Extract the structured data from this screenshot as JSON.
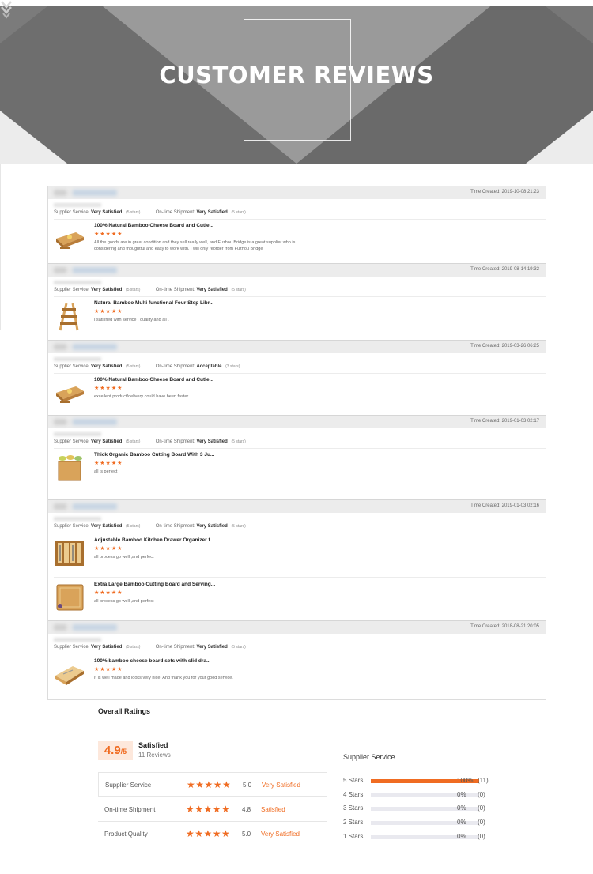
{
  "hero": {
    "title": "CUSTOMER REVIEWS"
  },
  "reviews": [
    {
      "time": "Time Created: 2019-10-08 21:23",
      "supplier_service_label": "Supplier Service:",
      "supplier_service_value": "Very Satisfied",
      "supplier_service_stars": "(5 stars)",
      "shipment_label": "On-time Shipment:",
      "shipment_value": "Very Satisfied",
      "shipment_stars": "(5 stars)",
      "items": [
        {
          "title": "100% Natural Bamboo Cheese Board and Cutle...",
          "stars": "★★★★★",
          "comment": "All the goods are in great condition and they sell really well, and Fuzhou Bridge is a great supplier who is considering and thoughtful and easy to work with. I will only reorder from Fuzhou Bridge",
          "thumb": "cheese-board"
        }
      ]
    },
    {
      "time": "Time Created: 2019-08-14 19:32",
      "supplier_service_label": "Supplier Service:",
      "supplier_service_value": "Very Satisfied",
      "supplier_service_stars": "(5 stars)",
      "shipment_label": "On-time Shipment:",
      "shipment_value": "Very Satisfied",
      "shipment_stars": "(5 stars)",
      "items": [
        {
          "title": "Natural Bamboo Multi functional Four Step Libr...",
          "stars": "★★★★★",
          "comment": "I satisfied with service , quality and all .",
          "thumb": "step-ladder"
        }
      ]
    },
    {
      "time": "Time Created: 2019-03-26 06:25",
      "supplier_service_label": "Supplier Service:",
      "supplier_service_value": "Very Satisfied",
      "supplier_service_stars": "(5 stars)",
      "shipment_label": "On-time Shipment:",
      "shipment_value": "Acceptable",
      "shipment_stars": "(3 stars)",
      "items": [
        {
          "title": "100% Natural Bamboo Cheese Board and Cutle...",
          "stars": "★★★★★",
          "comment": "excellent product!delivery could have been faster.",
          "thumb": "cheese-board"
        }
      ]
    },
    {
      "time": "Time Created: 2019-01-03 02:17",
      "supplier_service_label": "Supplier Service:",
      "supplier_service_value": "Very Satisfied",
      "supplier_service_stars": "(5 stars)",
      "shipment_label": "On-time Shipment:",
      "shipment_value": "Very Satisfied",
      "shipment_stars": "(5 stars)",
      "items": [
        {
          "title": "Thick Organic Bamboo Cutting Board With 3 Ju...",
          "stars": "★★★★★",
          "comment": "all is perfect",
          "thumb": "cutting-board-bowls"
        }
      ]
    },
    {
      "time": "Time Created: 2019-01-03 02:16",
      "supplier_service_label": "Supplier Service:",
      "supplier_service_value": "Very Satisfied",
      "supplier_service_stars": "(5 stars)",
      "shipment_label": "On-time Shipment:",
      "shipment_value": "Very Satisfied",
      "shipment_stars": "(5 stars)",
      "items": [
        {
          "title": "Adjustable Bamboo Kitchen Drawer Organizer f...",
          "stars": "★★★★★",
          "comment": "all process go well ,and perfect",
          "thumb": "drawer-organizer"
        },
        {
          "title": "Extra Large Bamboo Cutting Board and Serving...",
          "stars": "★★★★★",
          "comment": "all process go well ,and perfect",
          "thumb": "large-cutting-board"
        }
      ]
    },
    {
      "time": "Time Created: 2018-08-21 20:05",
      "supplier_service_label": "Supplier Service:",
      "supplier_service_value": "Very Satisfied",
      "supplier_service_stars": "(5 stars)",
      "shipment_label": "On-time Shipment:",
      "shipment_value": "Very Satisfied",
      "shipment_stars": "(5 stars)",
      "items": [
        {
          "title": "100% bamboo cheese board sets with slid dra...",
          "stars": "★★★★★",
          "comment": "It is well made and looks very nice! And thank you for your good service.",
          "thumb": "cheese-board-set"
        }
      ]
    }
  ],
  "overall": {
    "title": "Overall Ratings",
    "score": "4.9",
    "score_suffix": "/5",
    "label": "Satisfied",
    "review_count": "11 Reviews",
    "rows": [
      {
        "name": "Supplier Service",
        "stars": "★★★★★",
        "value": "5.0",
        "level": "Very Satisfied"
      },
      {
        "name": "On-time Shipment",
        "stars": "★★★★★",
        "value": "4.8",
        "level": "Satisfied"
      },
      {
        "name": "Product Quality",
        "stars": "★★★★★",
        "value": "5.0",
        "level": "Very Satisfied"
      }
    ]
  },
  "supplier_service": {
    "title": "Supplier Service",
    "accent_color": "#f06c22",
    "bars": [
      {
        "label": "5 Stars",
        "fraction": 1.0,
        "percent": "100%",
        "count": "(11)"
      },
      {
        "label": "4 Stars",
        "fraction": 0,
        "percent": "0%",
        "count": "(0)"
      },
      {
        "label": "3 Stars",
        "fraction": 0,
        "percent": "0%",
        "count": "(0)"
      },
      {
        "label": "2 Stars",
        "fraction": 0,
        "percent": "0%",
        "count": "(0)"
      },
      {
        "label": "1 Stars",
        "fraction": 0,
        "percent": "0%",
        "count": "(0)"
      }
    ]
  }
}
